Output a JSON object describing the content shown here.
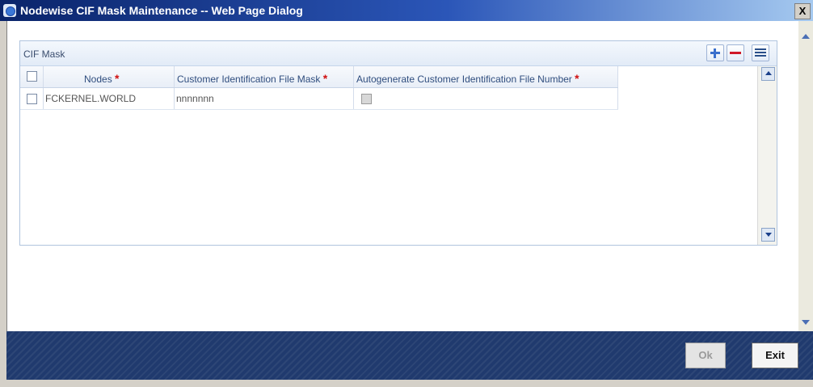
{
  "window": {
    "title": "Nodewise CIF Mask Maintenance -- Web Page Dialog",
    "close_label": "X"
  },
  "panel": {
    "title": "CIF Mask",
    "toolbar": {
      "add": "add-row-icon",
      "delete": "delete-row-icon",
      "view": "single-view-icon"
    }
  },
  "grid": {
    "columns": [
      {
        "label": "Nodes",
        "required": "*"
      },
      {
        "label": "Customer Identification File Mask",
        "required": "*"
      },
      {
        "label": "Autogenerate Customer Identification File Number",
        "required": "*"
      }
    ],
    "rows": [
      {
        "selected": false,
        "node": "FCKERNEL.WORLD",
        "mask": "nnnnnnn",
        "autogenerate": false
      }
    ]
  },
  "footer": {
    "ok_label": "Ok",
    "exit_label": "Exit"
  },
  "colors": {
    "title_bar": "#0a246a",
    "footer": "#203a6e",
    "required_marker": "#d01010"
  }
}
